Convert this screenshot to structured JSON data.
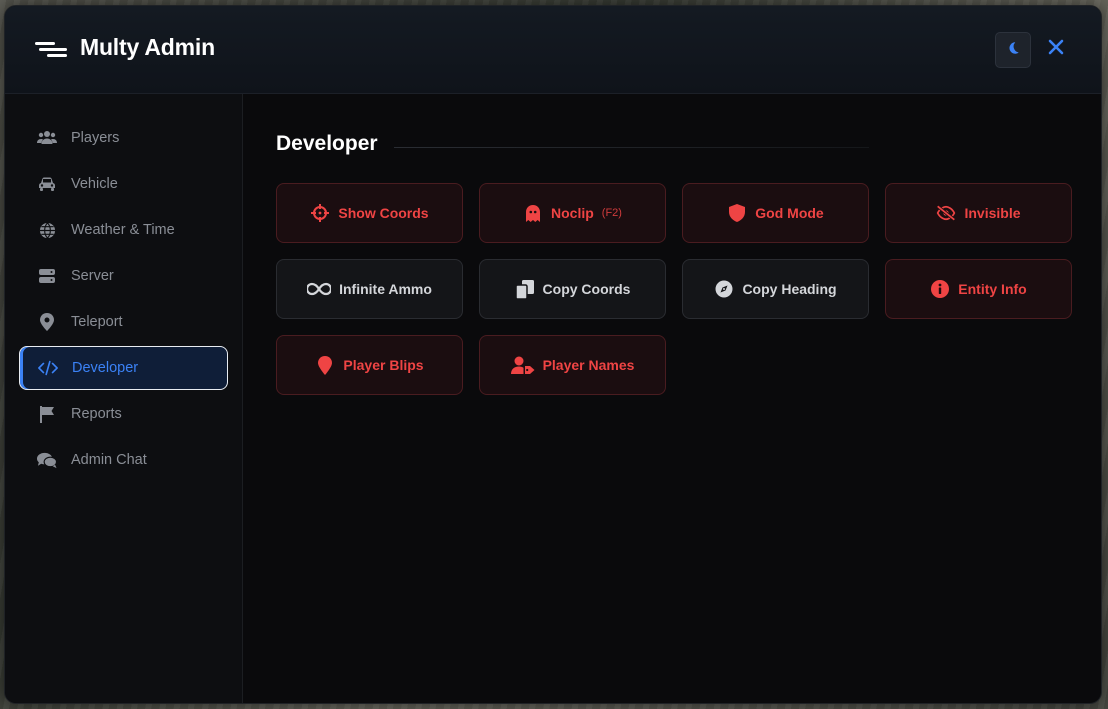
{
  "app": {
    "title": "Multy Admin"
  },
  "sidebar": {
    "items": [
      {
        "label": "Players",
        "icon": "users-icon"
      },
      {
        "label": "Vehicle",
        "icon": "car-icon"
      },
      {
        "label": "Weather & Time",
        "icon": "globe-icon"
      },
      {
        "label": "Server",
        "icon": "server-icon"
      },
      {
        "label": "Teleport",
        "icon": "map-pin-icon"
      },
      {
        "label": "Developer",
        "icon": "code-icon",
        "active": true
      },
      {
        "label": "Reports",
        "icon": "flag-icon"
      },
      {
        "label": "Admin Chat",
        "icon": "chat-icon"
      }
    ]
  },
  "main": {
    "section_title": "Developer",
    "buttons": [
      {
        "label": "Show Coords",
        "icon": "crosshair-icon",
        "state": "active"
      },
      {
        "label": "Noclip",
        "hint": "(F2)",
        "icon": "ghost-icon",
        "state": "active"
      },
      {
        "label": "God Mode",
        "icon": "shield-icon",
        "state": "active"
      },
      {
        "label": "Invisible",
        "icon": "eye-slash-icon",
        "state": "active"
      },
      {
        "label": "Infinite Ammo",
        "icon": "infinity-icon",
        "state": "inactive"
      },
      {
        "label": "Copy Coords",
        "icon": "copy-icon",
        "state": "inactive"
      },
      {
        "label": "Copy Heading",
        "icon": "compass-icon",
        "state": "inactive"
      },
      {
        "label": "Entity Info",
        "icon": "info-icon",
        "state": "active"
      },
      {
        "label": "Player Blips",
        "icon": "map-marker-icon",
        "state": "active"
      },
      {
        "label": "Player Names",
        "icon": "user-tag-icon",
        "state": "active"
      }
    ]
  },
  "colors": {
    "accent_blue": "#3b82f6",
    "active_red": "#ef4444",
    "background": "#0a0a0c"
  }
}
